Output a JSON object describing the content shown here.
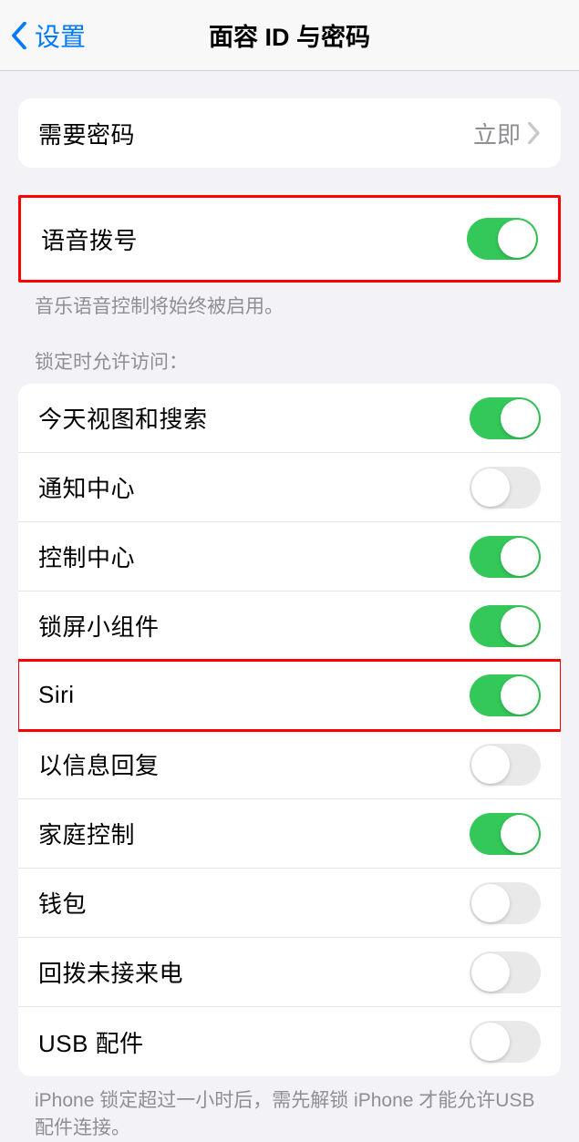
{
  "nav": {
    "back": "设置",
    "title": "面容 ID 与密码"
  },
  "passcode": {
    "label": "需要密码",
    "value": "立即"
  },
  "voice_dial": {
    "label": "语音拨号",
    "on": true,
    "footer": "音乐语音控制将始终被启用。"
  },
  "lock_access": {
    "header": "锁定时允许访问：",
    "items": [
      {
        "label": "今天视图和搜索",
        "on": true,
        "highlighted": false
      },
      {
        "label": "通知中心",
        "on": false,
        "highlighted": false
      },
      {
        "label": "控制中心",
        "on": true,
        "highlighted": false
      },
      {
        "label": "锁屏小组件",
        "on": true,
        "highlighted": false
      },
      {
        "label": "Siri",
        "on": true,
        "highlighted": true
      },
      {
        "label": "以信息回复",
        "on": false,
        "highlighted": false
      },
      {
        "label": "家庭控制",
        "on": true,
        "highlighted": false
      },
      {
        "label": "钱包",
        "on": false,
        "highlighted": false
      },
      {
        "label": "回拨未接来电",
        "on": false,
        "highlighted": false
      },
      {
        "label": "USB 配件",
        "on": false,
        "highlighted": false
      }
    ],
    "footer": "iPhone 锁定超过一小时后，需先解锁 iPhone 才能允许USB 配件连接。"
  }
}
